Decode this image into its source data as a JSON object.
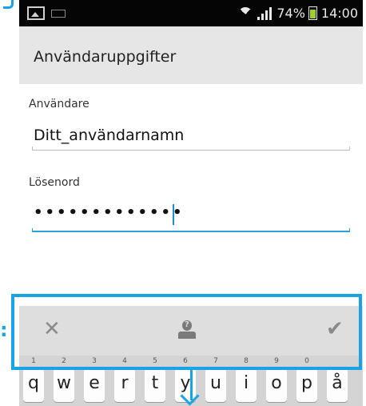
{
  "status_bar": {
    "battery_percent": "74%",
    "time": "14:00",
    "battery_level": 0.74
  },
  "header": {
    "title": "Användaruppgifter"
  },
  "form": {
    "user": {
      "label": "Användare",
      "value": "Ditt_användarnamn"
    },
    "password": {
      "label": "Lösenord",
      "value": "•••••••••••••"
    }
  },
  "suggestion_bar": {
    "dismiss_icon": "close-icon",
    "contact_icon": "person-unknown-icon",
    "confirm_icon": "checkmark-icon"
  },
  "keyboard": {
    "keys": [
      {
        "char": "q",
        "num": "1"
      },
      {
        "char": "w",
        "num": "2"
      },
      {
        "char": "e",
        "num": "3"
      },
      {
        "char": "r",
        "num": "4"
      },
      {
        "char": "t",
        "num": "5"
      },
      {
        "char": "y",
        "num": "6"
      },
      {
        "char": "u",
        "num": "7"
      },
      {
        "char": "i",
        "num": "8"
      },
      {
        "char": "o",
        "num": "9"
      },
      {
        "char": "p",
        "num": "0"
      },
      {
        "char": "å",
        "num": ""
      }
    ]
  },
  "colors": {
    "highlight": "#19a3e6",
    "focus_line": "#2ea1dc",
    "status_bar": "#050505",
    "title_bar": "#e6e6e6"
  }
}
